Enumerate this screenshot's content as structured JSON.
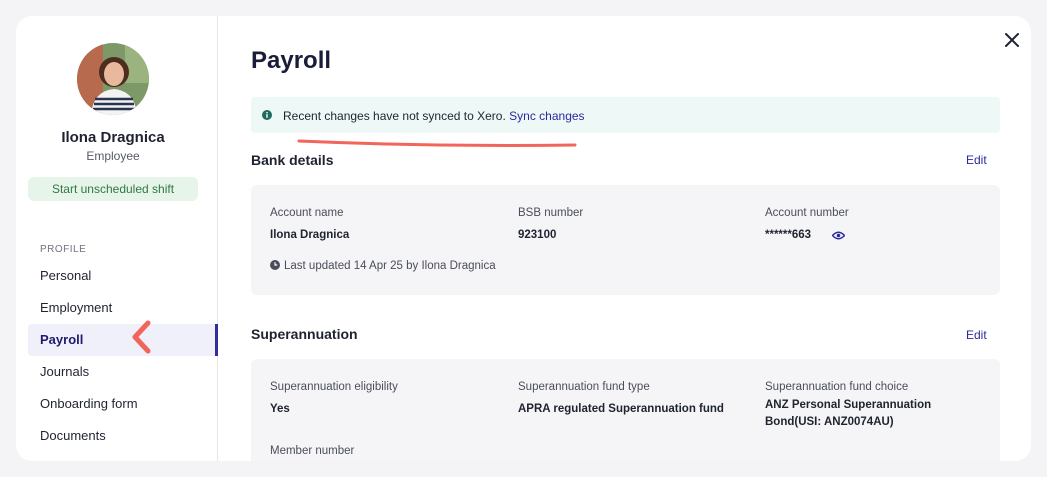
{
  "sidebar": {
    "user_name": "Ilona Dragnica",
    "user_role": "Employee",
    "shift_button": "Start unscheduled shift",
    "section_label": "PROFILE",
    "items": [
      {
        "label": "Personal"
      },
      {
        "label": "Employment"
      },
      {
        "label": "Payroll",
        "active": true
      },
      {
        "label": "Journals"
      },
      {
        "label": "Onboarding form"
      },
      {
        "label": "Documents"
      }
    ]
  },
  "main": {
    "title": "Payroll",
    "notice": {
      "text": "Recent changes have not synced to Xero.",
      "link": "Sync changes"
    },
    "bank": {
      "title": "Bank details",
      "edit": "Edit",
      "account_name_label": "Account name",
      "account_name": "Ilona Dragnica",
      "bsb_label": "BSB number",
      "bsb": "923100",
      "account_number_label": "Account number",
      "account_number": "******663",
      "last_updated": "Last updated 14 Apr 25 by Ilona Dragnica"
    },
    "super": {
      "title": "Superannuation",
      "edit": "Edit",
      "eligibility_label": "Superannuation eligibility",
      "eligibility": "Yes",
      "fund_type_label": "Superannuation fund type",
      "fund_type": "APRA regulated Superannuation fund",
      "fund_choice_label": "Superannuation fund choice",
      "fund_choice_line1": "ANZ Personal Superannuation",
      "fund_choice_line2": "Bond(USI: ANZ0074AU)",
      "member_label": "Member number"
    }
  },
  "colors": {
    "accent": "#332c99",
    "link": "#2b2a9c",
    "notice_bg": "#eef8f6",
    "shift_bg": "#e6f4e9",
    "shift_text": "#2f7a43",
    "annotation": "#f2655a"
  },
  "icons": [
    "close-icon",
    "info-icon",
    "eye-icon",
    "clock-icon",
    "chevron-left-icon"
  ]
}
